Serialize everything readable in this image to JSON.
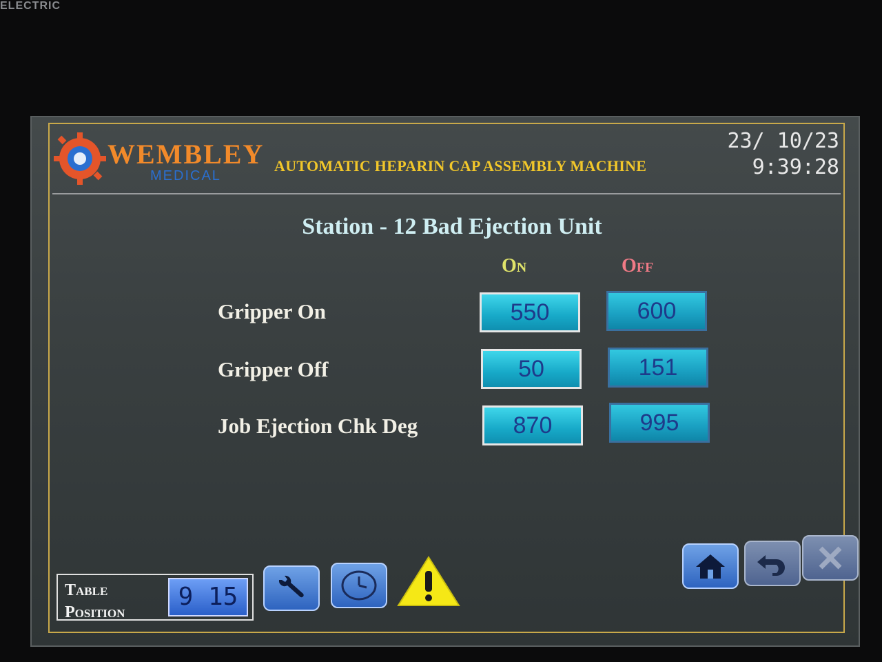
{
  "bezel": {
    "brand_text": "ELECTRIC"
  },
  "header": {
    "logo_word": "WEMBLEY",
    "logo_sub": "MEDICAL",
    "machine_title": "AUTOMATIC HEPARIN CAP ASSEMBLY MACHINE",
    "date": "23/ 10/23",
    "time": "9:39:28"
  },
  "station": {
    "title": "Station - 12 Bad Ejection Unit",
    "col_on": "On",
    "col_off": "Off",
    "rows": [
      {
        "label": "Gripper On",
        "on": "550",
        "off": "600"
      },
      {
        "label": "Gripper Off",
        "on": "50",
        "off": "151"
      },
      {
        "label": "Job Ejection Chk Deg",
        "on": "870",
        "off": "995"
      }
    ]
  },
  "footer": {
    "table_position_label_1": "Table",
    "table_position_label_2": "Position",
    "table_position_value": "9 15",
    "icons": [
      "wrench-icon",
      "clock-icon",
      "warning-icon",
      "home-icon",
      "back-icon",
      "close-icon"
    ]
  },
  "colors": {
    "title_yellow": "#f2c72a",
    "on_header": "#dfe36a",
    "off_header": "#f07a86",
    "value_box": "#17a9c8"
  }
}
